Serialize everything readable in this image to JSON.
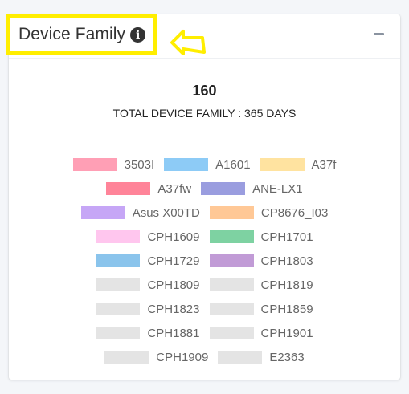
{
  "panel": {
    "title": "Device Family",
    "summary_value": "160",
    "summary_label": "TOTAL DEVICE FAMILY : 365 DAYS"
  },
  "colors": {
    "highlight": "#ffee00",
    "inactive_swatch": "#e4e4e4"
  },
  "legend": [
    [
      {
        "label": "3503I",
        "color": "#ff9fb5"
      },
      {
        "label": "A1601",
        "color": "#8dcbf6"
      },
      {
        "label": "A37f",
        "color": "#ffe3a0"
      }
    ],
    [
      {
        "label": "A37fw",
        "color": "#ff8499"
      },
      {
        "label": "ANE-LX1",
        "color": "#9a9ddf"
      }
    ],
    [
      {
        "label": "Asus X00TD",
        "color": "#c6a6f6"
      },
      {
        "label": "CP8676_I03",
        "color": "#ffc896"
      }
    ],
    [
      {
        "label": "CPH1609",
        "color": "#ffc6ee"
      },
      {
        "label": "CPH1701",
        "color": "#7ed2a2"
      }
    ],
    [
      {
        "label": "CPH1729",
        "color": "#8ac4ec"
      },
      {
        "label": "CPH1803",
        "color": "#c19bd6"
      }
    ],
    [
      {
        "label": "CPH1809",
        "color": "#e4e4e4"
      },
      {
        "label": "CPH1819",
        "color": "#e4e4e4"
      }
    ],
    [
      {
        "label": "CPH1823",
        "color": "#e4e4e4"
      },
      {
        "label": "CPH1859",
        "color": "#e4e4e4"
      }
    ],
    [
      {
        "label": "CPH1881",
        "color": "#e4e4e4"
      },
      {
        "label": "CPH1901",
        "color": "#e4e4e4"
      }
    ],
    [
      {
        "label": "CPH1909",
        "color": "#e4e4e4"
      },
      {
        "label": "E2363",
        "color": "#e4e4e4"
      }
    ]
  ]
}
